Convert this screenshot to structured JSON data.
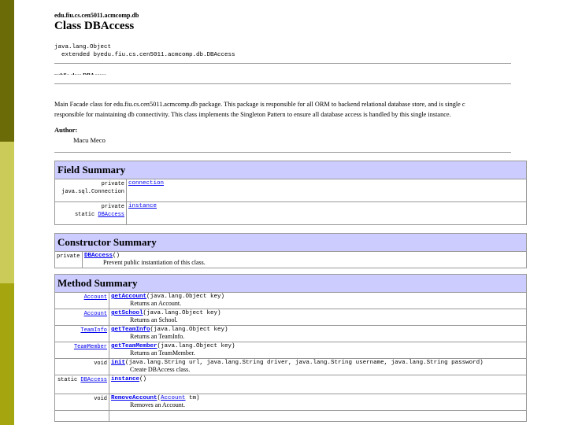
{
  "package_name": "edu.fiu.cs.cen5011.acmcomp.db",
  "class_title": "Class DBAccess",
  "hierarchy": {
    "line1": "java.lang.Object",
    "line2": "  extended byedu.fiu.cs.cen5011.acmcomp.db.DBAccess"
  },
  "cut_text": "public class DBAccess",
  "description": {
    "line1": "Main Facade class for edu.fiu.cs.cen5011.acmcomp.db package. This package is responsible for all ORM to backend relational database store, and is single c",
    "line2": "responsible for maintaining db connectivity. This class implements the Singleton Pattern to ensure all database access is handled by this single instance."
  },
  "author_label": "Author:",
  "author_name": "Macu Meco",
  "field_summary": {
    "title": "Field Summary",
    "rows": [
      {
        "mod": "private",
        "type": "java.sql.Connection",
        "name": "connection"
      },
      {
        "mod": "private",
        "type_prefix": "static ",
        "type_link": "DBAccess",
        "name": "instance"
      }
    ]
  },
  "constructor_summary": {
    "title": "Constructor Summary",
    "rows": [
      {
        "mod": "private",
        "name": "DBAccess",
        "sig": "()",
        "desc": "Prevent public instantiation of this class."
      }
    ]
  },
  "method_summary": {
    "title": "Method Summary",
    "rows": [
      {
        "type": "Account",
        "name": "getAccount",
        "sig": "(java.lang.Object key)",
        "desc": "Returns an Account."
      },
      {
        "type": "Account",
        "name": "getSchool",
        "sig": "(java.lang.Object key)",
        "desc": "Returns an School."
      },
      {
        "type": "TeamInfo",
        "name": "getTeamInfo",
        "sig": "(java.lang.Object key)",
        "desc": "Returns an TeamInfo."
      },
      {
        "type": "TeamMember",
        "name": "getTeamMember",
        "sig": "(java.lang.Object key)",
        "desc": "Returns an TeamMember."
      },
      {
        "type": "void",
        "name": "init",
        "sig": "(java.lang.String url, java.lang.String driver, java.lang.String username, java.lang.String password)",
        "desc": "Create DBAccess class."
      },
      {
        "type_prefix": "static ",
        "type": "DBAccess",
        "name": "instance",
        "sig": "()",
        "desc": ""
      },
      {
        "type": "void",
        "name": "RemoveAccount",
        "sig_pre": "(",
        "sig_link": "Account",
        "sig_post": " tm)",
        "desc": "Removes an Account."
      }
    ]
  },
  "colors": {
    "bar_dark": "#6b6b08",
    "bar_light": "#cbcb5a",
    "bar_mid": "#a5a510",
    "table_header": "#ccccff",
    "link": "#0000ee"
  }
}
